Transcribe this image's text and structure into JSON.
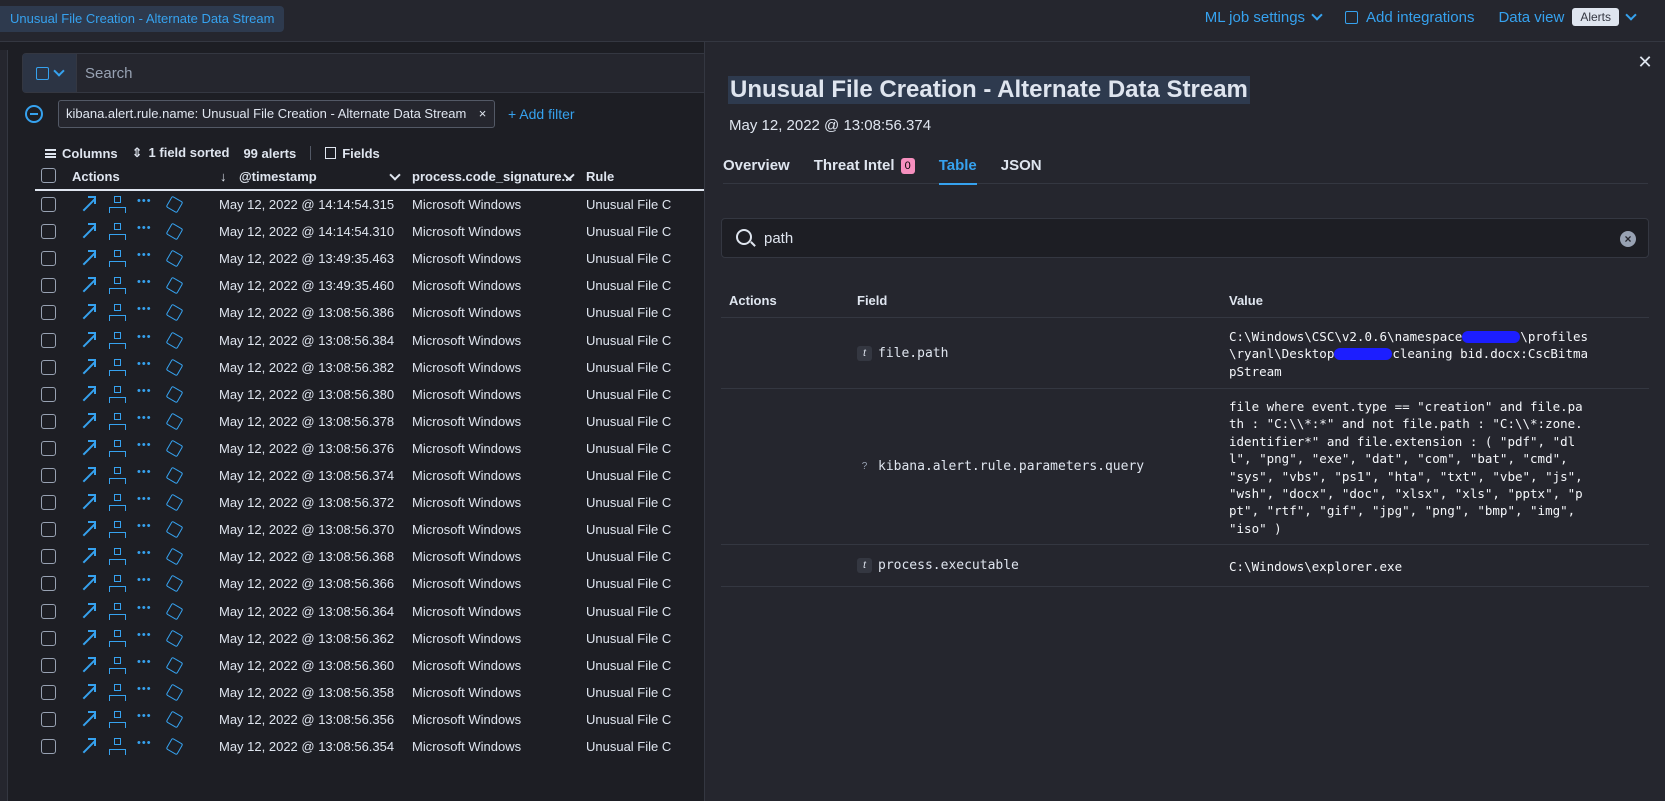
{
  "breadcrumb": "Unusual File Creation - Alternate Data Stream",
  "topnav": {
    "ml_job_settings": "ML job settings",
    "add_integrations": "Add integrations",
    "data_view_label": "Data view",
    "data_view_value": "Alerts"
  },
  "search": {
    "placeholder": "Search"
  },
  "filter_pill": "kibana.alert.rule.name: Unusual File Creation - Alternate Data Stream",
  "add_filter": "+ Add filter",
  "grid_toolbar": {
    "columns": "Columns",
    "sorted": "1 field sorted",
    "count": "99 alerts",
    "fields": "Fields"
  },
  "grid_columns": {
    "actions": "Actions",
    "timestamp": "@timestamp",
    "signature": "process.code_signature...",
    "rule": "Rule"
  },
  "rows": [
    {
      "ts": "May 12, 2022 @ 14:14:54.315",
      "sig": "Microsoft Windows",
      "rule": "Unusual File C"
    },
    {
      "ts": "May 12, 2022 @ 14:14:54.310",
      "sig": "Microsoft Windows",
      "rule": "Unusual File C"
    },
    {
      "ts": "May 12, 2022 @ 13:49:35.463",
      "sig": "Microsoft Windows",
      "rule": "Unusual File C"
    },
    {
      "ts": "May 12, 2022 @ 13:49:35.460",
      "sig": "Microsoft Windows",
      "rule": "Unusual File C"
    },
    {
      "ts": "May 12, 2022 @ 13:08:56.386",
      "sig": "Microsoft Windows",
      "rule": "Unusual File C"
    },
    {
      "ts": "May 12, 2022 @ 13:08:56.384",
      "sig": "Microsoft Windows",
      "rule": "Unusual File C"
    },
    {
      "ts": "May 12, 2022 @ 13:08:56.382",
      "sig": "Microsoft Windows",
      "rule": "Unusual File C"
    },
    {
      "ts": "May 12, 2022 @ 13:08:56.380",
      "sig": "Microsoft Windows",
      "rule": "Unusual File C"
    },
    {
      "ts": "May 12, 2022 @ 13:08:56.378",
      "sig": "Microsoft Windows",
      "rule": "Unusual File C"
    },
    {
      "ts": "May 12, 2022 @ 13:08:56.376",
      "sig": "Microsoft Windows",
      "rule": "Unusual File C"
    },
    {
      "ts": "May 12, 2022 @ 13:08:56.374",
      "sig": "Microsoft Windows",
      "rule": "Unusual File C"
    },
    {
      "ts": "May 12, 2022 @ 13:08:56.372",
      "sig": "Microsoft Windows",
      "rule": "Unusual File C"
    },
    {
      "ts": "May 12, 2022 @ 13:08:56.370",
      "sig": "Microsoft Windows",
      "rule": "Unusual File C"
    },
    {
      "ts": "May 12, 2022 @ 13:08:56.368",
      "sig": "Microsoft Windows",
      "rule": "Unusual File C"
    },
    {
      "ts": "May 12, 2022 @ 13:08:56.366",
      "sig": "Microsoft Windows",
      "rule": "Unusual File C"
    },
    {
      "ts": "May 12, 2022 @ 13:08:56.364",
      "sig": "Microsoft Windows",
      "rule": "Unusual File C"
    },
    {
      "ts": "May 12, 2022 @ 13:08:56.362",
      "sig": "Microsoft Windows",
      "rule": "Unusual File C"
    },
    {
      "ts": "May 12, 2022 @ 13:08:56.360",
      "sig": "Microsoft Windows",
      "rule": "Unusual File C"
    },
    {
      "ts": "May 12, 2022 @ 13:08:56.358",
      "sig": "Microsoft Windows",
      "rule": "Unusual File C"
    },
    {
      "ts": "May 12, 2022 @ 13:08:56.356",
      "sig": "Microsoft Windows",
      "rule": "Unusual File C"
    },
    {
      "ts": "May 12, 2022 @ 13:08:56.354",
      "sig": "Microsoft Windows",
      "rule": "Unusual File C"
    }
  ],
  "flyout": {
    "title": "Unusual File Creation - Alternate Data Stream",
    "date": "May 12, 2022 @ 13:08:56.374",
    "tabs": {
      "overview": "Overview",
      "threat_intel": "Threat Intel",
      "threat_intel_count": "0",
      "table": "Table",
      "json": "JSON"
    },
    "search_value": "path",
    "table_headers": {
      "actions": "Actions",
      "field": "Field",
      "value": "Value"
    },
    "fields": [
      {
        "field": "file.path",
        "value_a": "C:\\Windows\\CSC\\v2.0.6\\namespace",
        "value_b": "\\profiles\\ryanl\\Desktop",
        "value_c": "cleaning bid.docx:CscBitmapStream"
      },
      {
        "field": "kibana.alert.rule.parameters.query",
        "value": "file where event.type == \"creation\" and file.path : \"C:\\\\*:*\" and not file.path : \"C:\\\\*:zone.identifier*\" and file.extension : ( \"pdf\", \"dll\", \"png\", \"exe\", \"dat\", \"com\", \"bat\", \"cmd\", \"sys\", \"vbs\", \"ps1\", \"hta\", \"txt\", \"vbe\", \"js\", \"wsh\", \"docx\", \"doc\", \"xlsx\", \"xls\", \"pptx\", \"ppt\", \"rtf\", \"gif\", \"jpg\", \"png\", \"bmp\", \"img\", \"iso\" )"
      },
      {
        "field": "process.executable",
        "value": "C:\\Windows\\explorer.exe"
      }
    ]
  },
  "colors": {
    "accent": "#36a2ef",
    "background": "#1d1e24",
    "panel": "#25262e",
    "badge": "#f68fbe"
  }
}
